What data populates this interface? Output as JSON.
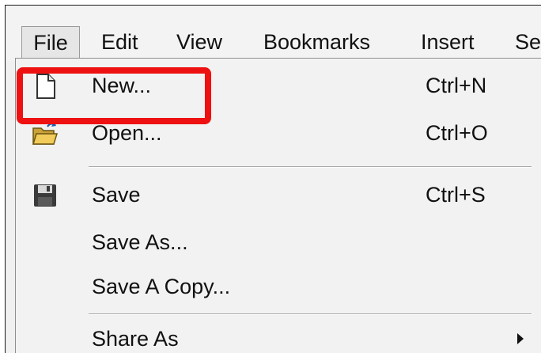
{
  "menubar": {
    "items": [
      {
        "label": "File",
        "active": true
      },
      {
        "label": "Edit"
      },
      {
        "label": "View"
      },
      {
        "label": "Bookmarks"
      },
      {
        "label": "Insert"
      },
      {
        "label": "Se"
      }
    ]
  },
  "file_menu": {
    "items": [
      {
        "label": "New...",
        "shortcut": "Ctrl+N",
        "icon": "new-document-icon"
      },
      {
        "label": "Open...",
        "shortcut": "Ctrl+O",
        "icon": "open-folder-icon"
      },
      {
        "label": "Save",
        "shortcut": "Ctrl+S",
        "icon": "save-floppy-icon"
      },
      {
        "label": "Save As...",
        "shortcut": ""
      },
      {
        "label": "Save A Copy...",
        "shortcut": ""
      },
      {
        "label": "Share As",
        "shortcut": "",
        "submenu": true,
        "icon": "submenu-arrow-icon"
      }
    ]
  },
  "annotation": {
    "highlight_color": "#ee1111",
    "highlighted_item": "New..."
  }
}
